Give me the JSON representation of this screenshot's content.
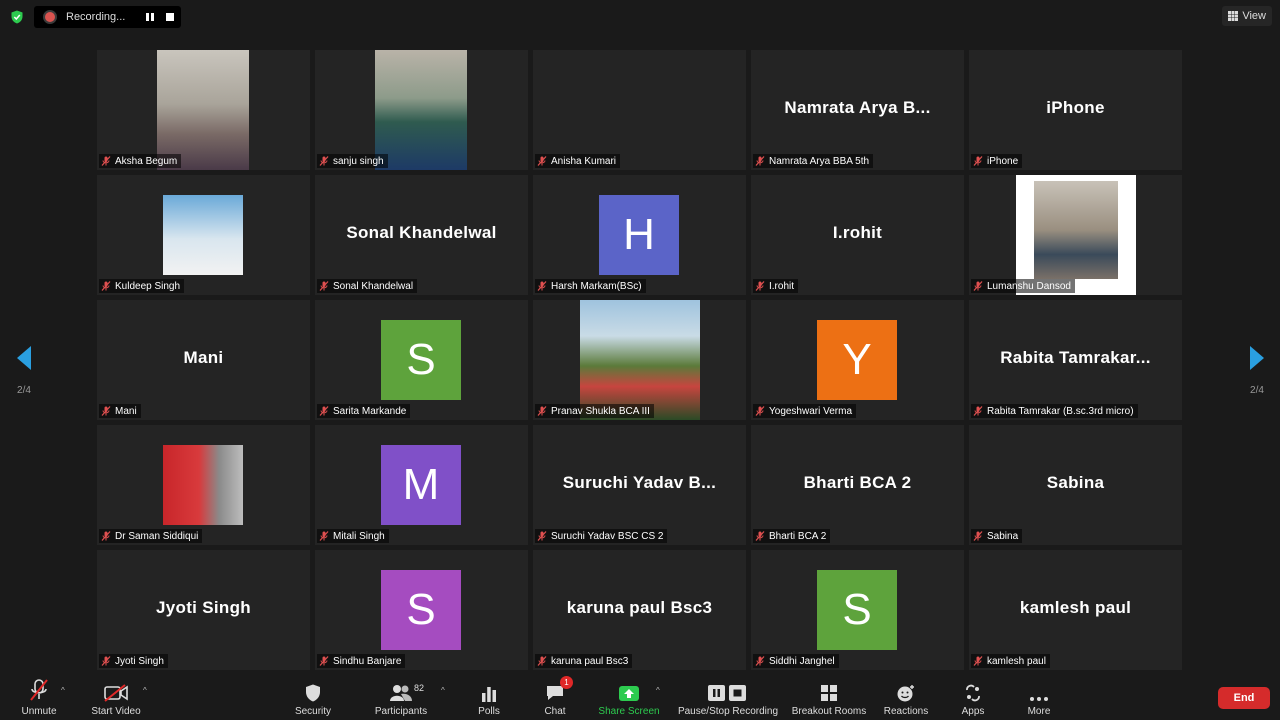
{
  "recording": {
    "label": "Recording..."
  },
  "view_button": {
    "label": "View"
  },
  "pagination": {
    "left": "2/4",
    "right": "2/4"
  },
  "tiles": [
    {
      "label": "Aksha Begum"
    },
    {
      "label": "sanju singh"
    },
    {
      "label": "Anisha Kumari"
    },
    {
      "label": "Namrata Arya BBA 5th",
      "display": "Namrata Arya B..."
    },
    {
      "label": "iPhone",
      "display": "iPhone"
    },
    {
      "label": "Kuldeep Singh"
    },
    {
      "label": "Sonal Khandelwal",
      "display": "Sonal Khandelwal"
    },
    {
      "label": "Harsh Markam(BSc)",
      "initial": "H",
      "color": "#5b64c8"
    },
    {
      "label": "I.rohit",
      "display": "I.rohit"
    },
    {
      "label": "Lumanshu Dansod"
    },
    {
      "label": "Mani",
      "display": "Mani"
    },
    {
      "label": "Sarita Markande",
      "initial": "S",
      "color": "#5ea33c"
    },
    {
      "label": "Pranav Shukla BCA III"
    },
    {
      "label": "Yogeshwari Verma",
      "initial": "Y",
      "color": "#ed7014"
    },
    {
      "label": "Rabita Tamrakar  (B.sc.3rd micro)",
      "display": "Rabita  Tamrakar..."
    },
    {
      "label": "Dr Saman Siddiqui"
    },
    {
      "label": "Mitali Singh",
      "initial": "M",
      "color": "#8050c8"
    },
    {
      "label": "Suruchi Yadav BSC CS 2",
      "display": "Suruchi  Yadav  B..."
    },
    {
      "label": "Bharti BCA 2",
      "display": "Bharti BCA 2"
    },
    {
      "label": "Sabina",
      "display": "Sabina"
    },
    {
      "label": "Jyoti Singh",
      "display": "Jyoti Singh"
    },
    {
      "label": "Sindhu Banjare",
      "initial": "S",
      "color": "#a54cc0"
    },
    {
      "label": "karuna paul Bsc3",
      "display": "karuna paul Bsc3"
    },
    {
      "label": "Siddhi Janghel",
      "initial": "S",
      "color": "#5ea33c"
    },
    {
      "label": "kamlesh paul",
      "display": "kamlesh paul"
    }
  ],
  "toolbar": {
    "unmute": "Unmute",
    "start_video": "Start Video",
    "security": "Security",
    "participants": "Participants",
    "participants_count": "82",
    "polls": "Polls",
    "chat": "Chat",
    "chat_badge": "1",
    "share_screen": "Share Screen",
    "pause_stop_recording": "Pause/Stop Recording",
    "breakout_rooms": "Breakout Rooms",
    "reactions": "Reactions",
    "apps": "Apps",
    "more": "More",
    "end": "End"
  },
  "colors": {
    "accent_green": "#2dcb4f",
    "end_red": "#d52b2b",
    "nav_blue": "#2a9fe0"
  }
}
